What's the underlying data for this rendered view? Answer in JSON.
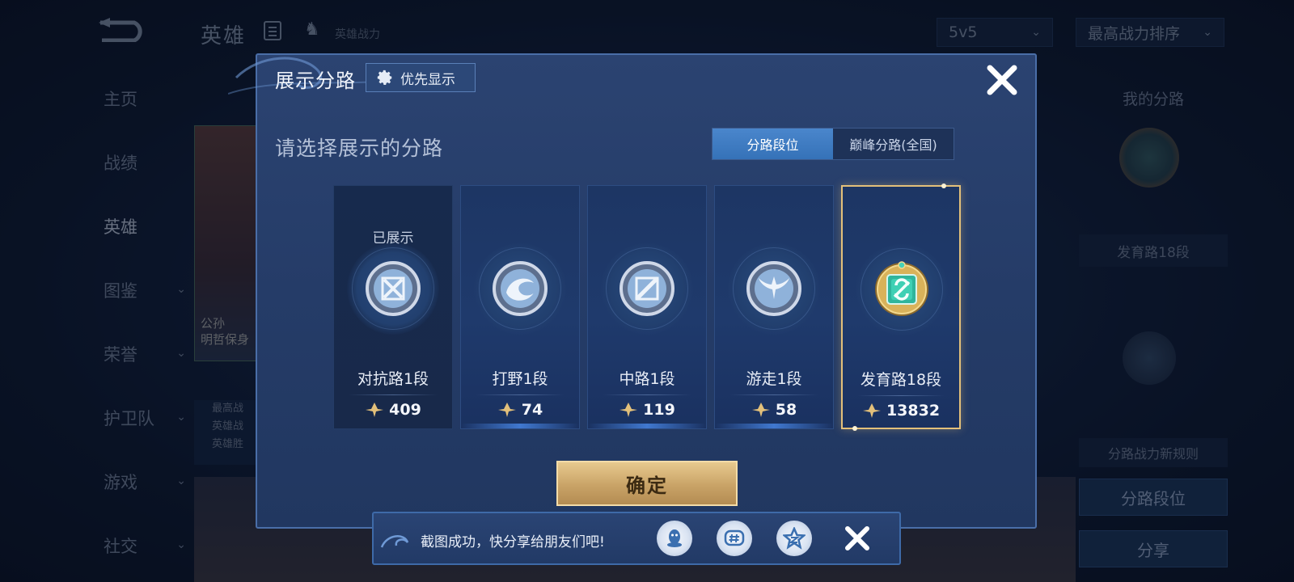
{
  "background": {
    "title": "英雄",
    "power_label": "英雄战力",
    "mode_select": "5v5",
    "sort_select": "最高战力排序",
    "nav": [
      {
        "label": "主页",
        "has_chevron": false
      },
      {
        "label": "战绩",
        "has_chevron": false
      },
      {
        "label": "英雄",
        "has_chevron": false
      },
      {
        "label": "图鉴",
        "has_chevron": true
      },
      {
        "label": "荣誉",
        "has_chevron": true
      },
      {
        "label": "护卫队",
        "has_chevron": true
      },
      {
        "label": "游戏",
        "has_chevron": true
      },
      {
        "label": "社交",
        "has_chevron": true
      }
    ],
    "hero_caption_1": "公孙",
    "hero_caption_2": "明哲保身",
    "hero_stats": [
      "最高战",
      "英雄战",
      "英雄胜"
    ],
    "right": {
      "my_lane_title": "我的分路",
      "my_lane_rank": "发育路18段",
      "rule_text": "分路战力新规则",
      "rank_button": "分路段位",
      "share_button": "分享"
    }
  },
  "modal": {
    "title": "展示分路",
    "priority_button": "优先显示",
    "subtitle": "请选择展示的分路",
    "tabs": [
      {
        "label": "分路段位",
        "active": true
      },
      {
        "label": "巅峰分路(全国)",
        "active": false
      }
    ],
    "lanes": [
      {
        "name": "对抗路1段",
        "power": "409",
        "status": "已展示",
        "emblem": "clash-lane-emblem-icon",
        "selected": false
      },
      {
        "name": "打野1段",
        "power": "74",
        "status": "",
        "emblem": "jungle-emblem-icon",
        "selected": false
      },
      {
        "name": "中路1段",
        "power": "119",
        "status": "",
        "emblem": "mid-lane-emblem-icon",
        "selected": false
      },
      {
        "name": "游走1段",
        "power": "58",
        "status": "",
        "emblem": "roam-emblem-icon",
        "selected": false
      },
      {
        "name": "发育路18段",
        "power": "13832",
        "status": "",
        "emblem": "farm-lane-emblem-icon",
        "selected": true
      }
    ],
    "confirm_button": "确定"
  },
  "share_bar": {
    "message": "截图成功，快分享给朋友们吧!",
    "icons": [
      "qq-icon",
      "hashtag-icon",
      "qzone-star-icon"
    ]
  },
  "colors": {
    "modal_bg": "#253c68",
    "accent_blue": "#3f7cc4",
    "gold": "#e3c07a",
    "text_primary": "#ffffff"
  }
}
